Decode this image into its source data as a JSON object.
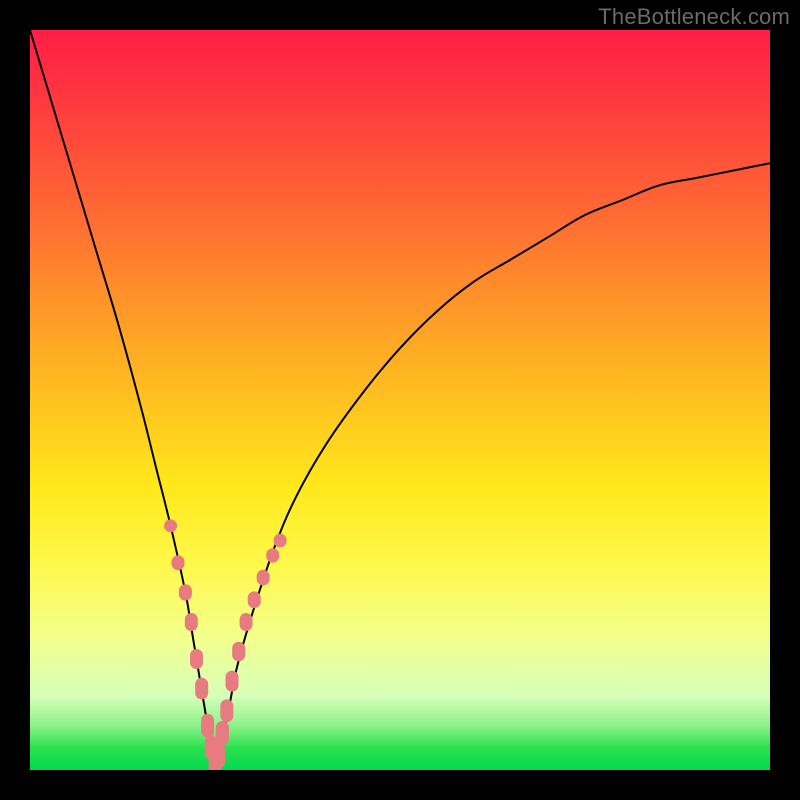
{
  "watermark": {
    "text": "TheBottleneck.com"
  },
  "colors": {
    "curve": "#000000",
    "marker_fill": "#e77b80",
    "marker_stroke": "#b44b53"
  },
  "chart_data": {
    "type": "line",
    "title": "",
    "xlabel": "",
    "ylabel": "",
    "xlim": [
      0,
      100
    ],
    "ylim": [
      0,
      100
    ],
    "grid": false,
    "legend": false,
    "note": "Bottleneck-style V-curve. x is a normalized component-balance axis (0–100); y is bottleneck percentage (0–100). Minimum y ≈ 0 occurs at x ≈ 25. Left branch steeper; right branch rises to y ≈ 82 at x = 100.",
    "series": [
      {
        "name": "bottleneck_curve",
        "x": [
          0,
          3,
          6,
          9,
          12,
          15,
          17,
          19,
          21,
          22,
          23,
          24,
          25,
          26,
          27,
          28,
          30,
          33,
          36,
          40,
          45,
          50,
          55,
          60,
          65,
          70,
          75,
          80,
          85,
          90,
          95,
          100
        ],
        "y": [
          100,
          90,
          80,
          70,
          60,
          49,
          41,
          33,
          24,
          18,
          12,
          6,
          0,
          4,
          9,
          14,
          21,
          30,
          37,
          44,
          51,
          57,
          62,
          66,
          69,
          72,
          75,
          77,
          79,
          80,
          81,
          82
        ]
      }
    ],
    "markers": {
      "name": "highlight_band",
      "note": "Pink rounded markers clustered on both branches near the minimum, roughly y ∈ [0,30].",
      "x": [
        19,
        20,
        21,
        21.8,
        22.5,
        23.2,
        24,
        24.5,
        25,
        25.5,
        26,
        26.6,
        27.3,
        28.2,
        29.2,
        30.3,
        31.5,
        32.8,
        33.8
      ],
      "y": [
        33,
        28,
        24,
        20,
        15,
        11,
        6,
        3,
        0,
        2,
        5,
        8,
        12,
        16,
        20,
        23,
        26,
        29,
        31
      ]
    }
  }
}
